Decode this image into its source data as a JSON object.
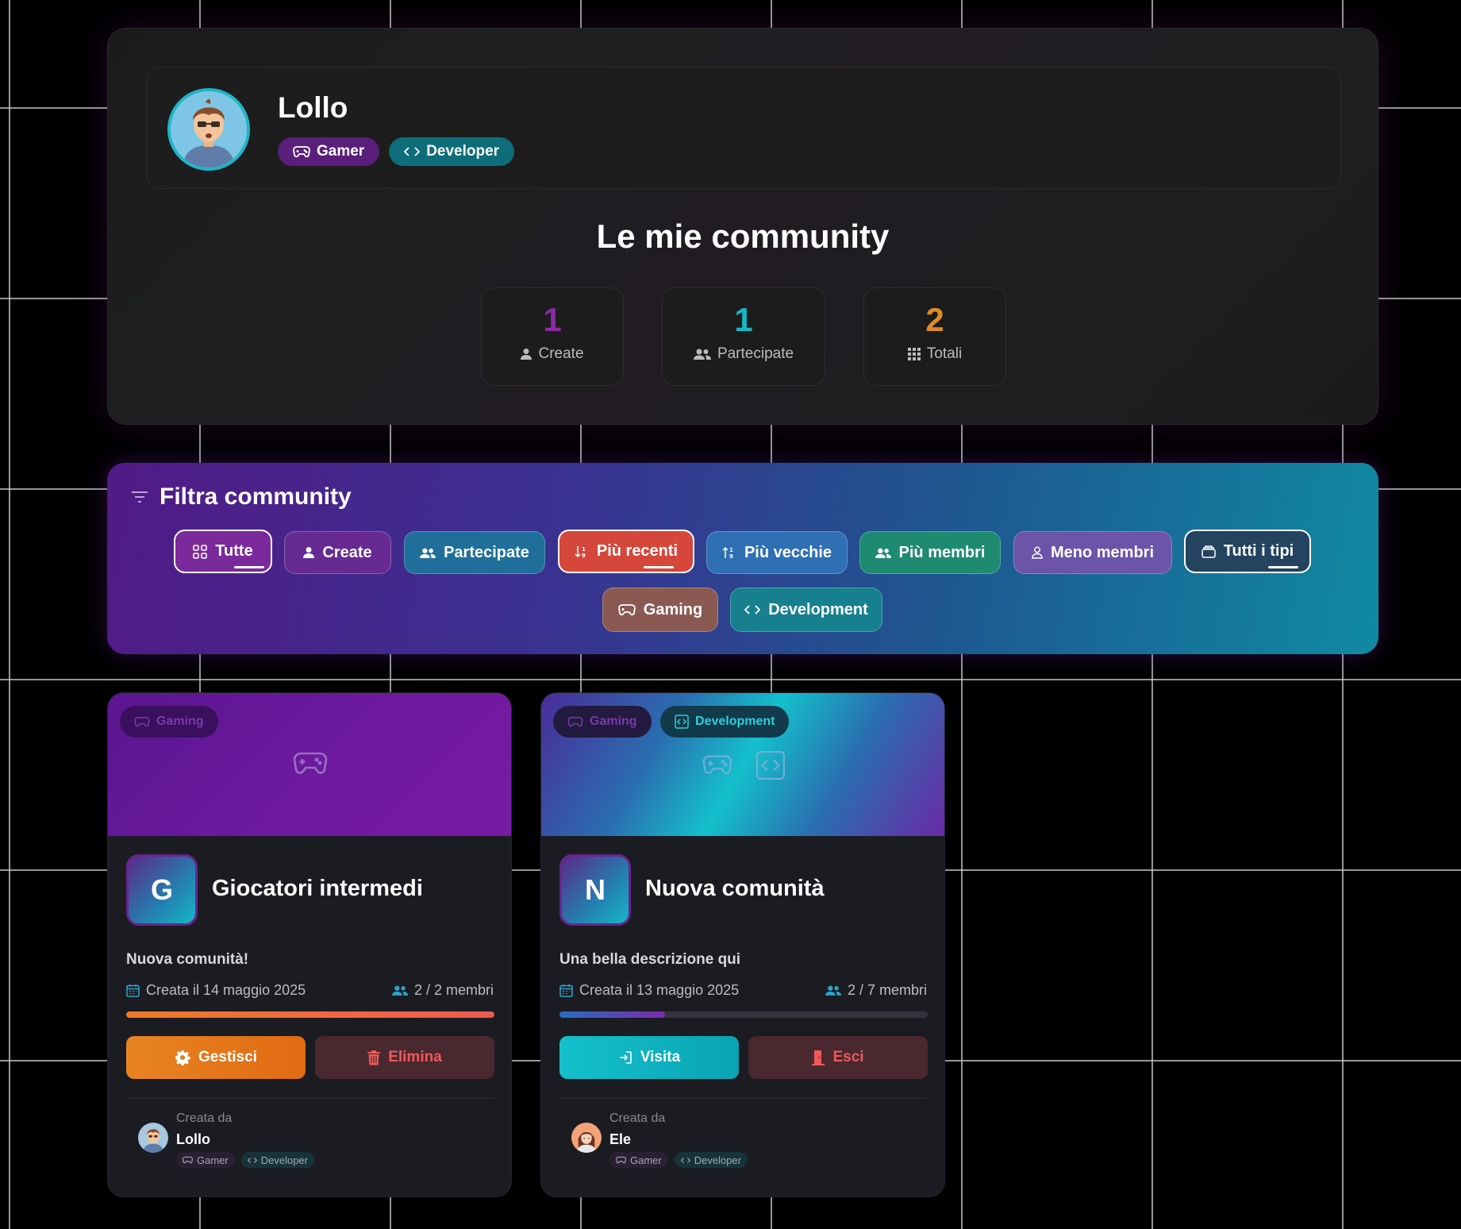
{
  "profile": {
    "name": "Lollo",
    "roles": [
      {
        "label": "Gamer",
        "icon": "gamepad-icon"
      },
      {
        "label": "Developer",
        "icon": "code-icon"
      }
    ]
  },
  "section_title": "Le mie community",
  "stats": [
    {
      "value": "1",
      "label": "Create",
      "icon": "user-icon",
      "color": "#8a2aa0"
    },
    {
      "value": "1",
      "label": "Partecipate",
      "icon": "users-icon",
      "color": "#17b7c4"
    },
    {
      "value": "2",
      "label": "Totali",
      "icon": "grid-icon",
      "color": "#e08a25"
    }
  ],
  "filter": {
    "title": "Filtra community",
    "chips": [
      {
        "label": "Tutte",
        "icon": "grid-icon",
        "active": true
      },
      {
        "label": "Create",
        "icon": "user-icon"
      },
      {
        "label": "Partecipate",
        "icon": "users-icon"
      },
      {
        "label": "Più recenti",
        "icon": "sort-desc-icon",
        "active": true
      },
      {
        "label": "Più vecchie",
        "icon": "sort-asc-icon"
      },
      {
        "label": "Più membri",
        "icon": "users-icon"
      },
      {
        "label": "Meno membri",
        "icon": "user-outline-icon"
      },
      {
        "label": "Tutti i tipi",
        "icon": "layers-icon",
        "active": true
      },
      {
        "label": "Gaming",
        "icon": "gamepad-icon"
      },
      {
        "label": "Development",
        "icon": "code-icon"
      }
    ]
  },
  "communities": [
    {
      "tags": [
        "Gaming"
      ],
      "letter": "G",
      "name": "Giocatori intermedi",
      "description": "Nuova comunità!",
      "created": "Creata il 14 maggio 2025",
      "members": "2 / 2 membri",
      "fill_fraction": 1.0,
      "primary_action": "Gestisci",
      "secondary_action": "Elimina",
      "created_by_label": "Creata da",
      "creator": "Lollo",
      "creator_roles": [
        "Gamer",
        "Developer"
      ]
    },
    {
      "tags": [
        "Gaming",
        "Development"
      ],
      "letter": "N",
      "name": "Nuova comunità",
      "description": "Una bella descrizione qui",
      "created": "Creata il 13 maggio 2025",
      "members": "2 / 7 membri",
      "fill_fraction": 0.286,
      "primary_action": "Visita",
      "secondary_action": "Esci",
      "created_by_label": "Creata da",
      "creator": "Ele",
      "creator_roles": [
        "Gamer",
        "Developer"
      ]
    }
  ]
}
